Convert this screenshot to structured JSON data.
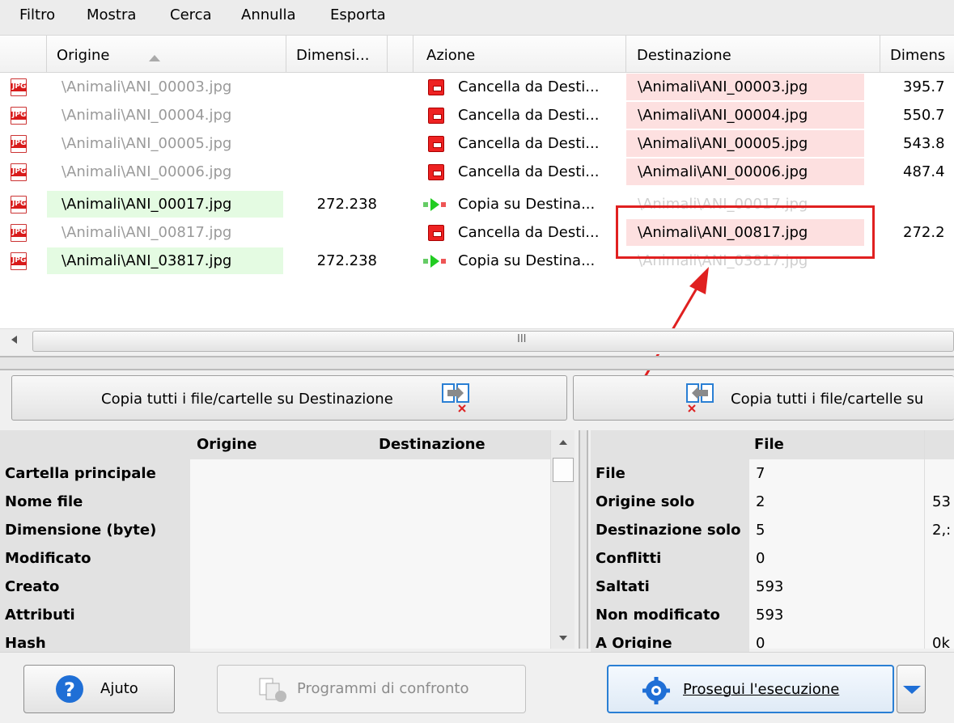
{
  "menu": [
    "Filtro",
    "Mostra",
    "Cerca",
    "Annulla",
    "Esporta"
  ],
  "columns": {
    "origin": "Origine",
    "size": "Dimensi...",
    "action": "Azione",
    "destination": "Destinazione",
    "dest_size": "Dimens"
  },
  "rows": [
    {
      "origin": "\\Animali\\ANI_00003.jpg",
      "size": "",
      "action": "Cancella da Desti...",
      "destination": "\\Animali\\ANI_00003.jpg",
      "dest_size": "395.7"
    },
    {
      "origin": "\\Animali\\ANI_00004.jpg",
      "size": "",
      "action": "Cancella da Desti...",
      "destination": "\\Animali\\ANI_00004.jpg",
      "dest_size": "550.7"
    },
    {
      "origin": "\\Animali\\ANI_00005.jpg",
      "size": "",
      "action": "Cancella da Desti...",
      "destination": "\\Animali\\ANI_00005.jpg",
      "dest_size": "543.8"
    },
    {
      "origin": "\\Animali\\ANI_00006.jpg",
      "size": "",
      "action": "Cancella da Desti...",
      "destination": "\\Animali\\ANI_00006.jpg",
      "dest_size": "487.4"
    },
    {
      "origin": "\\Animali\\ANI_00017.jpg",
      "size": "272.238",
      "action": "Copia su Destina...",
      "destination": "\\Animali\\ANI_00017.jpg",
      "dest_size": ""
    },
    {
      "origin": "\\Animali\\ANI_00817.jpg",
      "size": "",
      "action": "Cancella da Desti...",
      "destination": "\\Animali\\ANI_00817.jpg",
      "dest_size": "272.2"
    },
    {
      "origin": "\\Animali\\ANI_03817.jpg",
      "size": "272.238",
      "action": "Copia su Destina...",
      "destination": "\\Animali\\ANI_03817.jpg",
      "dest_size": ""
    }
  ],
  "file_icon_label": "JPG",
  "hscroll_grip": "III",
  "copy_to_dest": "Copia tutti i file/cartelle su Destinazione",
  "copy_to_origin": "Copia tutti i file/cartelle su",
  "props": {
    "headers": [
      "Origine",
      "Destinazione"
    ],
    "labels": [
      "Cartella principale",
      "Nome file",
      "Dimensione (byte)",
      "Modificato",
      "Creato",
      "Attributi",
      "Hash"
    ]
  },
  "stats": {
    "header": "File",
    "rows": [
      {
        "label": "File",
        "value": "7",
        "extra": ""
      },
      {
        "label": "Origine solo",
        "value": "2",
        "extra": "53"
      },
      {
        "label": "Destinazione solo",
        "value": "5",
        "extra": "2,:"
      },
      {
        "label": "Conflitti",
        "value": "0",
        "extra": ""
      },
      {
        "label": "Saltati",
        "value": "593",
        "extra": ""
      },
      {
        "label": "Non modificato",
        "value": "593",
        "extra": ""
      },
      {
        "label": "A Origine",
        "value": "0",
        "extra": "0k"
      }
    ]
  },
  "buttons": {
    "help": "Ajuto",
    "compare": "Programmi di confronto",
    "continue": "Prosegui l'esecuzione"
  },
  "colors": {
    "highlight": "#e02020",
    "green_cell": "#e4fbe2",
    "red_cell": "#fde0e0",
    "accent": "#1f6fd6"
  }
}
